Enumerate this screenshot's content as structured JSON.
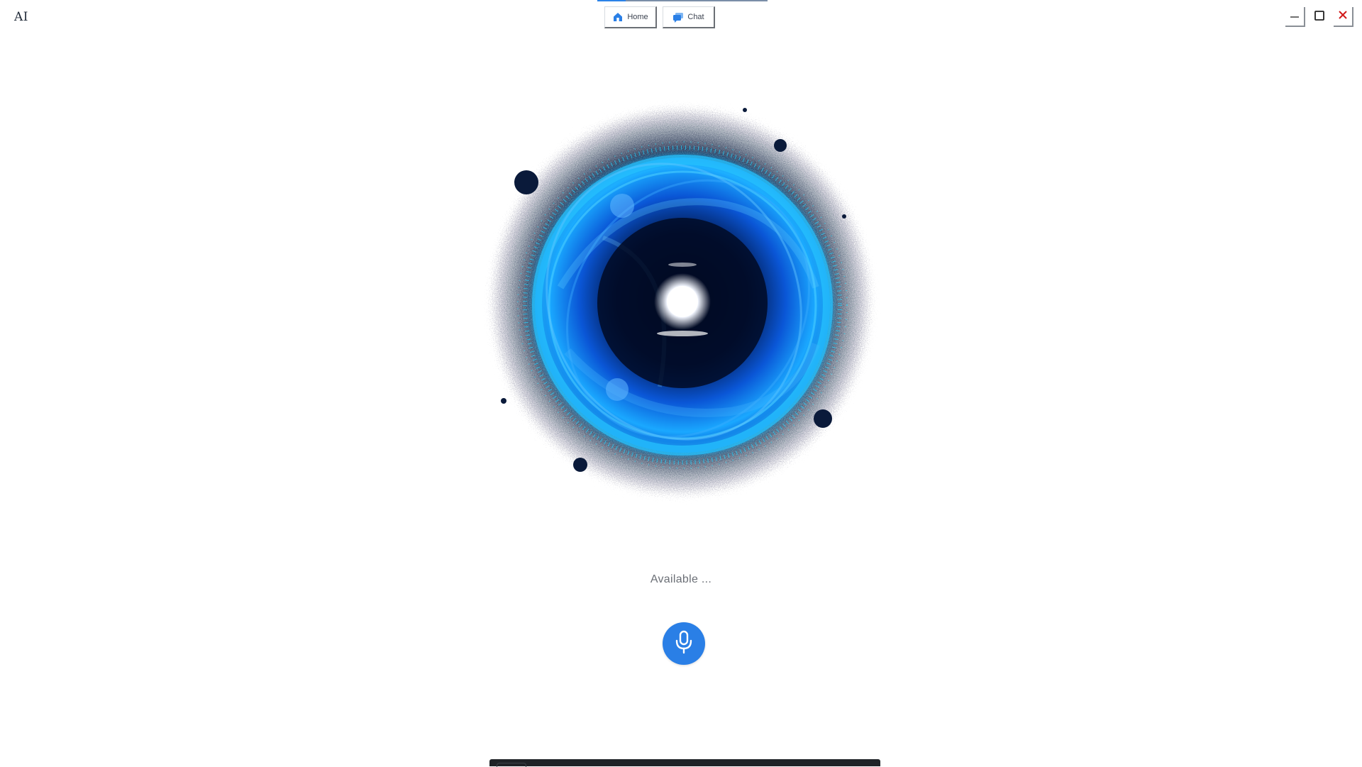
{
  "app": {
    "title": "AI"
  },
  "tabs": [
    {
      "label": "Home",
      "icon": "home-icon"
    },
    {
      "label": "Chat",
      "icon": "chat-icon"
    }
  ],
  "window_controls": {
    "minimize_icon": "minimize-icon",
    "maximize_icon": "maximize-icon",
    "close_icon": "close-icon"
  },
  "assistant": {
    "status": "Available ...",
    "mic_icon": "microphone-icon"
  },
  "colors": {
    "accent": "#2a7fe6",
    "orb_glow": "#19c6ff",
    "orb_core": "#010a24",
    "close": "#d11a1a"
  }
}
